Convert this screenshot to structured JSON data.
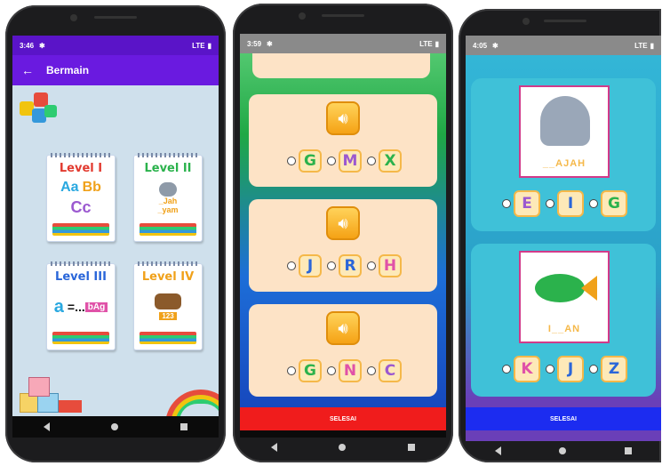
{
  "phone1": {
    "status_time": "3:46",
    "status_icons": "LTE",
    "appbar_title": "Bermain",
    "levels": [
      {
        "title": "Level I",
        "color": "#e23a2f",
        "content_a": "Aa",
        "content_b": "Bb",
        "content_c": "Cc"
      },
      {
        "title": "Level II",
        "color": "#2bb24c",
        "content_a": "_Jah",
        "content_b": "_yam"
      },
      {
        "title": "Level III",
        "color": "#2a66d9",
        "content_a": "a",
        "content_b": "=...",
        "content_c": "bAg"
      },
      {
        "title": "Level IV",
        "color": "#f0a11a",
        "content_a": "123"
      }
    ]
  },
  "phone2": {
    "status_time": "3:59",
    "status_icons": "LTE",
    "questions": [
      {
        "options": [
          "G",
          "M",
          "X"
        ]
      },
      {
        "options": [
          "J",
          "R",
          "H"
        ]
      },
      {
        "options": [
          "G",
          "N",
          "C"
        ]
      }
    ],
    "button_label": "SELESAI"
  },
  "phone3": {
    "status_time": "4:05",
    "status_icons": "LTE",
    "questions": [
      {
        "image": "elephant-icon",
        "word": "__AJAH",
        "options": [
          "E",
          "I",
          "G"
        ]
      },
      {
        "image": "fish-icon",
        "word": "I__AN",
        "options": [
          "K",
          "J",
          "Z"
        ]
      }
    ],
    "button_label": "SELESAI"
  },
  "colors": {
    "purple": "#6a1ae0",
    "red_button": "#f01c1c",
    "blue_button": "#1c2cf0",
    "tile_bg": "#fde9b8"
  }
}
